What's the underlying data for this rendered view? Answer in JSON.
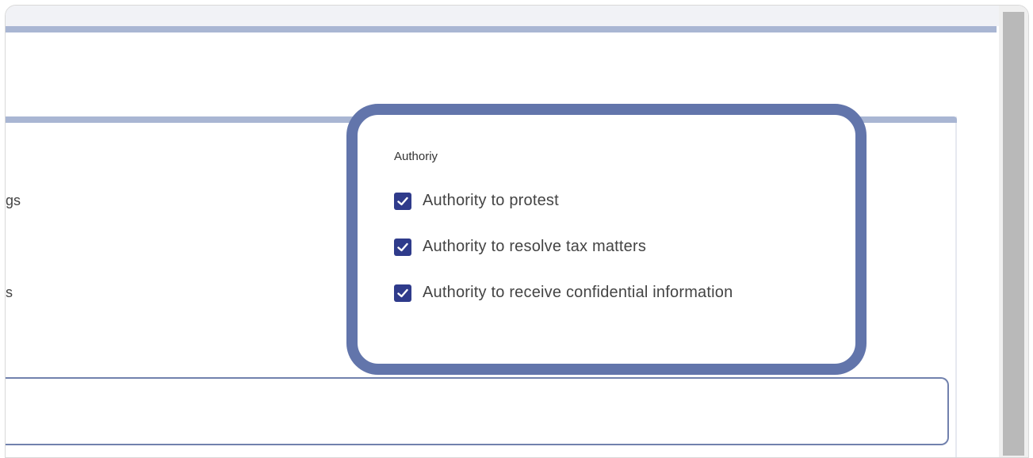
{
  "left_labels": [
    "gs",
    "s"
  ],
  "authority": {
    "title": "Authoriy",
    "options": [
      {
        "label": "Authority to protest",
        "checked": true
      },
      {
        "label": "Authority to resolve tax matters",
        "checked": true
      },
      {
        "label": "Authority to receive confidential information",
        "checked": true
      }
    ]
  },
  "colors": {
    "accent": "#a9b6d3",
    "focus_ring": "#6275ab",
    "checkbox": "#2f3b8b"
  }
}
